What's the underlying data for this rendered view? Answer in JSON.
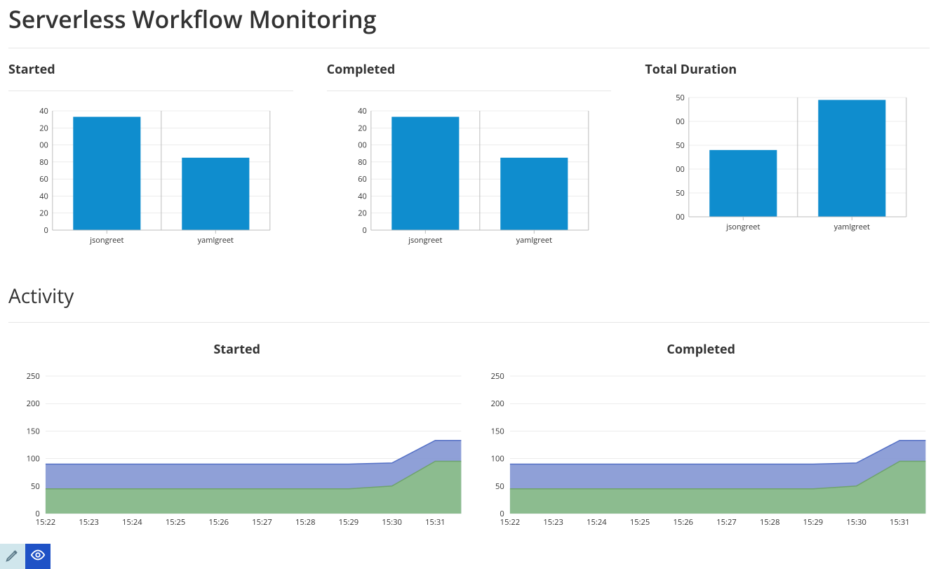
{
  "page_title": "Serverless Workflow Monitoring",
  "section_activity": "Activity",
  "bar_panels": [
    {
      "title": "Started"
    },
    {
      "title": "Completed"
    },
    {
      "title": "Total Duration"
    }
  ],
  "area_panels": [
    {
      "title": "Started"
    },
    {
      "title": "Completed"
    }
  ],
  "chart_data": [
    {
      "id": "started_bar",
      "type": "bar",
      "title": "Started",
      "categories": [
        "jsongreet",
        "yamlgreet"
      ],
      "values": [
        133,
        85
      ],
      "ytick_labels": [
        "0",
        "20",
        "40",
        "60",
        "80",
        "00",
        "20",
        "40"
      ],
      "ylim": [
        0,
        140
      ]
    },
    {
      "id": "completed_bar",
      "type": "bar",
      "title": "Completed",
      "categories": [
        "jsongreet",
        "yamlgreet"
      ],
      "values": [
        133,
        85
      ],
      "ytick_labels": [
        "0",
        "20",
        "40",
        "60",
        "80",
        "00",
        "20",
        "40"
      ],
      "ylim": [
        0,
        140
      ]
    },
    {
      "id": "duration_bar",
      "type": "bar",
      "title": "Total Duration",
      "categories": [
        "jsongreet",
        "yamlgreet"
      ],
      "values": [
        140,
        245
      ],
      "ytick_labels": [
        "00",
        "50",
        "00",
        "50",
        "00",
        "50"
      ],
      "ylim": [
        0,
        250
      ]
    },
    {
      "id": "activity_started",
      "type": "area",
      "title": "Started",
      "x": [
        "15:22",
        "15:23",
        "15:24",
        "15:25",
        "15:26",
        "15:27",
        "15:28",
        "15:29",
        "15:30",
        "15:31"
      ],
      "ytick_labels": [
        "0",
        "50",
        "100",
        "150",
        "200",
        "250"
      ],
      "ylim": [
        0,
        250
      ],
      "series": [
        {
          "name": "series-blue",
          "values": [
            90,
            90,
            90,
            90,
            90,
            90,
            90,
            90,
            92,
            133
          ]
        },
        {
          "name": "series-green",
          "values": [
            45,
            45,
            45,
            45,
            45,
            45,
            45,
            45,
            50,
            95
          ]
        }
      ]
    },
    {
      "id": "activity_completed",
      "type": "area",
      "title": "Completed",
      "x": [
        "15:22",
        "15:23",
        "15:24",
        "15:25",
        "15:26",
        "15:27",
        "15:28",
        "15:29",
        "15:30",
        "15:31"
      ],
      "ytick_labels": [
        "0",
        "50",
        "100",
        "150",
        "200",
        "250"
      ],
      "ylim": [
        0,
        250
      ],
      "series": [
        {
          "name": "series-blue",
          "values": [
            90,
            90,
            90,
            90,
            90,
            90,
            90,
            90,
            92,
            133
          ]
        },
        {
          "name": "series-green",
          "values": [
            45,
            45,
            45,
            45,
            45,
            45,
            45,
            45,
            50,
            95
          ]
        }
      ]
    }
  ]
}
